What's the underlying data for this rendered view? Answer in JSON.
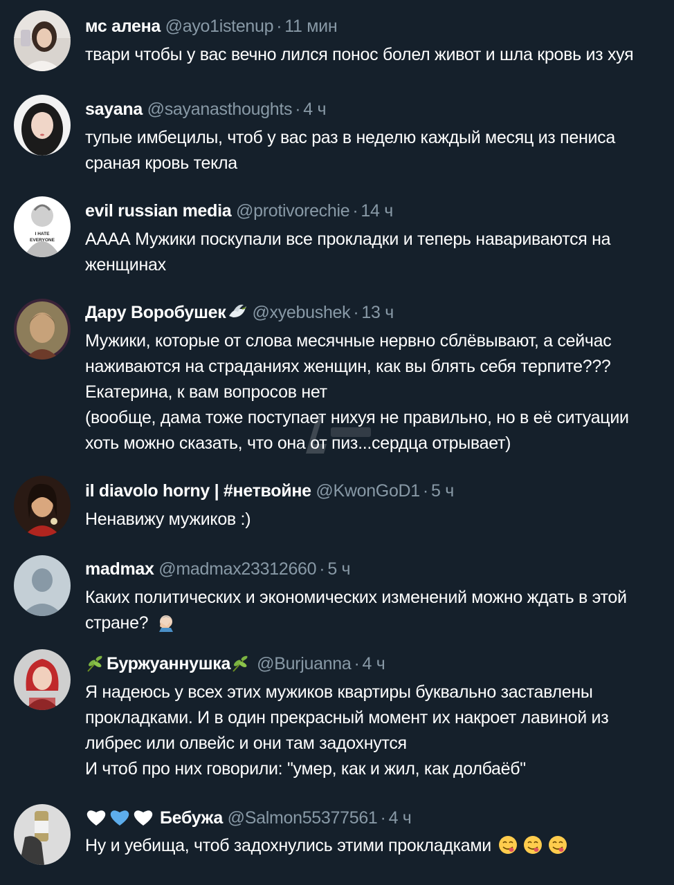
{
  "tweets": [
    {
      "name": "мс алена",
      "handle": "@ayo1istenup",
      "dot": "·",
      "time": "11 мин",
      "lines": [
        "твари чтобы у вас вечно лился понос болел живот и шла кровь из хуя"
      ]
    },
    {
      "name": "sayana",
      "handle": "@sayanasthoughts",
      "dot": "·",
      "time": "4 ч",
      "lines": [
        "тупые имбецилы, чтоб у вас раз в неделю каждый месяц из пениса",
        "сраная кровь текла"
      ]
    },
    {
      "name": "evil russian media",
      "handle": "@protivorechie",
      "dot": "·",
      "time": "14 ч",
      "avatar_text": [
        "I HATE",
        "EVERYONE"
      ],
      "lines": [
        "АААА Мужики поскупали все прокладки и теперь навариваются на",
        "женщинах"
      ]
    },
    {
      "name": "Дару Воробушек",
      "name_icon": "dove-emoji",
      "handle": "@xyebushek",
      "dot": "·",
      "time": "13 ч",
      "lines": [
        "Мужики, которые от слова месячные нервно сблёвывают, а сейчас",
        "наживаются на страданиях женщин, как вы блять себя терпите???",
        "Екатерина, к вам вопросов нет",
        "(вообще, дама тоже поступает нихуя не правильно, но в её ситуации",
        "хоть можно сказать, что она от пиз...сердца отрывает)"
      ]
    },
    {
      "name": "il diavolo horny | #нетвойне",
      "handle": "@KwonGoD1",
      "dot": "·",
      "time": "5 ч",
      "lines": [
        "Ненавижу мужиков :)"
      ]
    },
    {
      "name": "madmax",
      "handle": "@madmax23312660",
      "dot": "·",
      "time": "5 ч",
      "lines": [
        "Каких политических и экономических изменений можно ждать в этой",
        "стране?"
      ],
      "line_icon": "facepalm-emoji"
    },
    {
      "name": "Буржуаннушка",
      "name_icon": "herb-emoji",
      "handle": "@Burjuanna",
      "dot": "·",
      "time": "4 ч",
      "lines": [
        "Я надеюсь у всех этих мужиков квартиры буквально заставлены",
        "прокладками. И в один прекрасный момент их накроет лавиной из",
        "либрес или олвейс и они там задохнутся",
        "И чтоб про них говорили: \"умер, как и жил, как долбаёб\""
      ]
    },
    {
      "name": "Бебужа",
      "name_icon": "hearts-emoji",
      "handle": "@Salmon55377561",
      "dot": "·",
      "time": "4 ч",
      "lines": [
        "Ну и уебища, чтоб задохнулись этими прокладками"
      ],
      "line_icon": "yum-face-emoji"
    }
  ],
  "colors": {
    "background": "#15202b",
    "text": "#ffffff",
    "secondary": "#8899a6"
  }
}
